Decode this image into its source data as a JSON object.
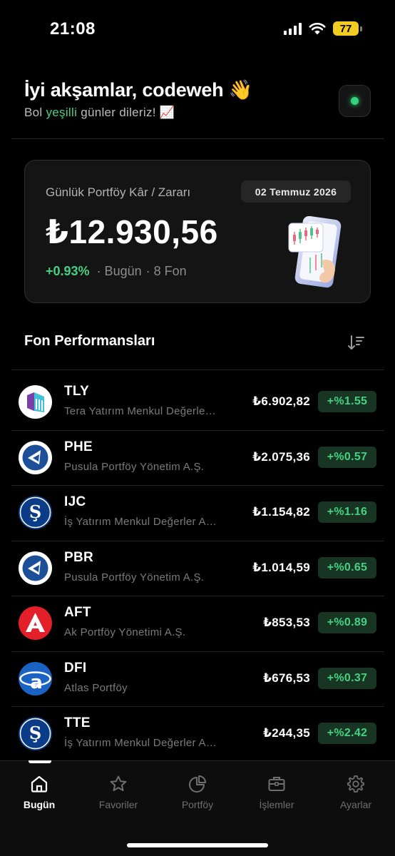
{
  "status": {
    "time": "21:08",
    "battery": "77"
  },
  "header": {
    "greeting": "İyi akşamlar, codeweh 👋",
    "subtitle_prefix": "Bol ",
    "subtitle_highlight": "yeşilli",
    "subtitle_suffix": " günler dileriz! 📈"
  },
  "summary": {
    "label": "Günlük Portföy Kâr / Zararı",
    "date": "02 Temmuz 2026",
    "amount": "₺12.930,56",
    "change": "+0.93%",
    "period": "· Bugün",
    "fund_count": "· 8 Fon"
  },
  "section": {
    "title": "Fon Performansları"
  },
  "funds": [
    {
      "code": "TLY",
      "company": "Tera Yatırım Menkul Değerler A.Ş.",
      "value": "₺6.902,82",
      "change": "+%1.55",
      "logo": "tera-logo-icon"
    },
    {
      "code": "PHE",
      "company": "Pusula Portföy Yönetim A.Ş.",
      "value": "₺2.075,36",
      "change": "+%0.57",
      "logo": "pusula-logo-icon"
    },
    {
      "code": "IJC",
      "company": "İş Yatırım Menkul Değerler A.Ş.",
      "value": "₺1.154,82",
      "change": "+%1.16",
      "logo": "is-logo-icon"
    },
    {
      "code": "PBR",
      "company": "Pusula Portföy Yönetim A.Ş.",
      "value": "₺1.014,59",
      "change": "+%0.65",
      "logo": "pusula-logo-icon"
    },
    {
      "code": "AFT",
      "company": "Ak Portföy Yönetimi A.Ş.",
      "value": "₺853,53",
      "change": "+%0.89",
      "logo": "ak-logo-icon"
    },
    {
      "code": "DFI",
      "company": "Atlas Portföy",
      "value": "₺676,53",
      "change": "+%0.37",
      "logo": "atlas-logo-icon"
    },
    {
      "code": "TTE",
      "company": "İş Yatırım Menkul Değerler A.Ş.",
      "value": "₺244,35",
      "change": "+%2.42",
      "logo": "is-logo-icon"
    }
  ],
  "tabs": [
    {
      "label": "Bugün",
      "icon": "home-icon",
      "active": true
    },
    {
      "label": "Favoriler",
      "icon": "star-icon"
    },
    {
      "label": "Portföy",
      "icon": "pie-chart-icon"
    },
    {
      "label": "İşlemler",
      "icon": "briefcase-icon"
    },
    {
      "label": "Ayarlar",
      "icon": "gear-icon"
    }
  ],
  "colors": {
    "accent_green": "#45d184",
    "battery": "#f2cc20",
    "live_dot": "#32d37a"
  }
}
